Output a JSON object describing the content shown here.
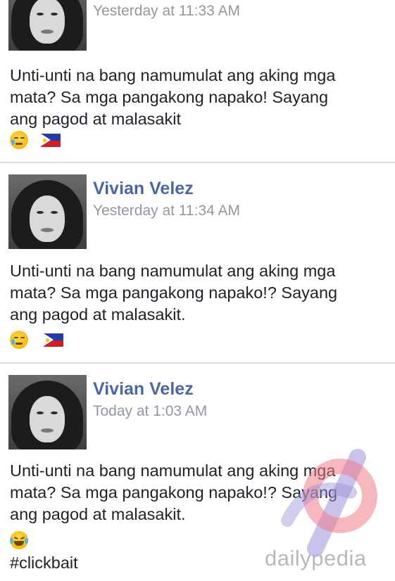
{
  "posts": [
    {
      "author": "",
      "timestamp": "Yesterday at 11:33 AM",
      "text_line1": "Unti-unti na bang namumulat ang aking mga",
      "text_line2": "mata? Sa mga pangakong napako! Sayang",
      "text_line3": "ang pagod at malasakit",
      "emojis": [
        "crying-face-icon",
        "philippine-flag-icon"
      ]
    },
    {
      "author": "Vivian Velez",
      "timestamp": "Yesterday at 11:34 AM",
      "text_line1": "Unti-unti na bang namumulat ang aking mga",
      "text_line2": "mata? Sa mga pangakong napako!? Sayang",
      "text_line3": "ang pagod at malasakit.",
      "emojis": [
        "crying-face-icon",
        "philippine-flag-icon"
      ]
    },
    {
      "author": "Vivian Velez",
      "timestamp": "Today at 1:03 AM",
      "text_line1": "Unti-unti na bang namumulat ang aking mga",
      "text_line2": "mata? Sa mga pangakong napako!? Sayang",
      "text_line3": "ang pagod at malasakit.",
      "emojis": [
        "laughing-tears-icon"
      ],
      "hashtag": "#clickbait"
    }
  ],
  "watermark": {
    "text": "dailypedia"
  },
  "colors": {
    "author": "#4b67a1",
    "timestamp": "#9197a3",
    "text": "#1d2129",
    "divider": "#dcdde1"
  }
}
